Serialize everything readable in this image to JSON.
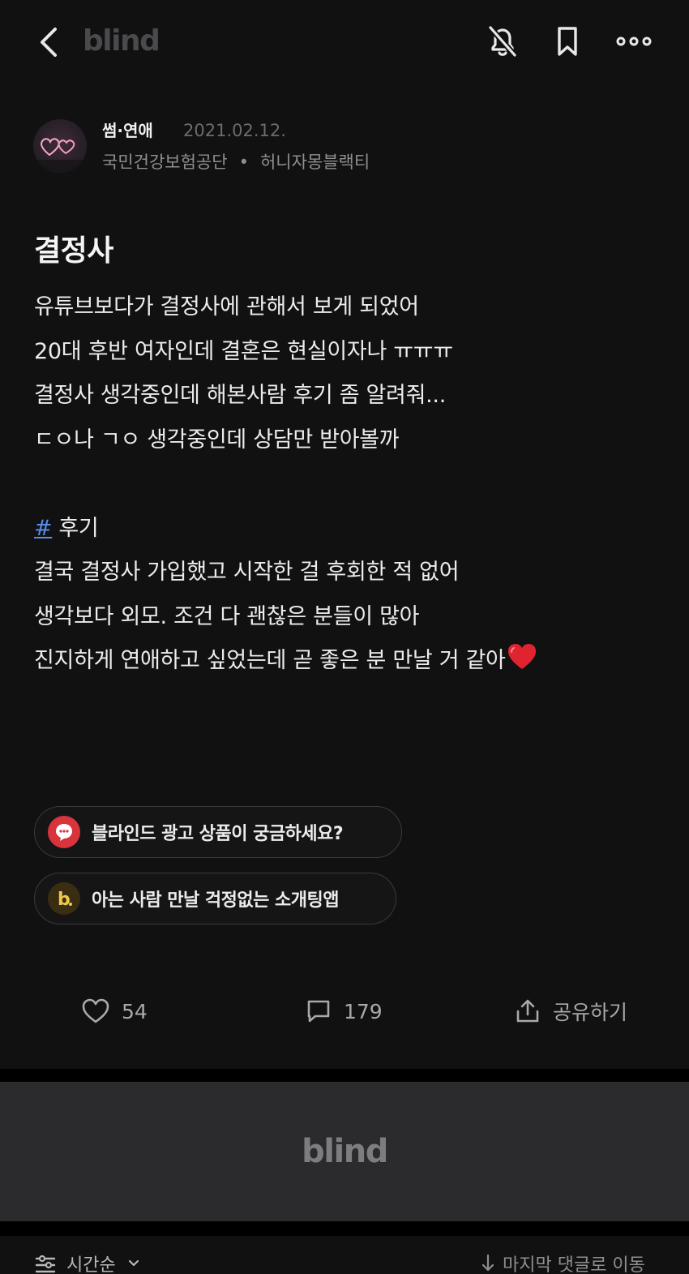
{
  "header": {
    "brand": "blind",
    "icons": [
      "back-icon",
      "bell-off-icon",
      "bookmark-icon",
      "more-icon"
    ]
  },
  "post": {
    "category": "썸·연애",
    "date": "2021.02.12.",
    "company": "국민건강보험공단",
    "nickname": "허니자몽블랙티",
    "title": "결정사",
    "body_lines": [
      "유튜브보다가 결정사에 관해서 보게 되었어",
      "20대 후반 여자인데 결혼은 현실이자나 ㅠㅠㅠ",
      "결정사 생각중인데 해본사람 후기 좀 알려줘...",
      "ㄷㅇ나 ㄱㅇ 생각중인데 상담만 받아볼까",
      "",
      "",
      "결국 결정사 가입했고 시작한 걸 후회한 적 없어",
      "생각보다 외모. 조건 다 괜찮은 분들이 많아",
      "진지하게 연애하고 싶었는데 곧 좋은 분 만날 거 같아"
    ],
    "hashtag_symbol": "#",
    "hashtag_text": "후기",
    "ending_emoji": "red-heart-icon"
  },
  "chips": [
    {
      "label": "블라인드 광고 상품이 궁금하세요?",
      "icon": "chat-bubble-icon",
      "color": "#d9333c"
    },
    {
      "label": "아는 사람 만날 걱정없는 소개팅앱",
      "icon": "b-logo-icon",
      "color": "#3a2e12"
    }
  ],
  "actions": {
    "like_count": "54",
    "comment_count": "179",
    "share_label": "공유하기"
  },
  "footer": {
    "brand": "blind"
  },
  "sortbar": {
    "sort_label": "시간순",
    "jump_label": "마지막 댓글로 이동"
  },
  "colors": {
    "background": "#111112",
    "link": "#5a8de8",
    "heart": "#e0242f"
  }
}
